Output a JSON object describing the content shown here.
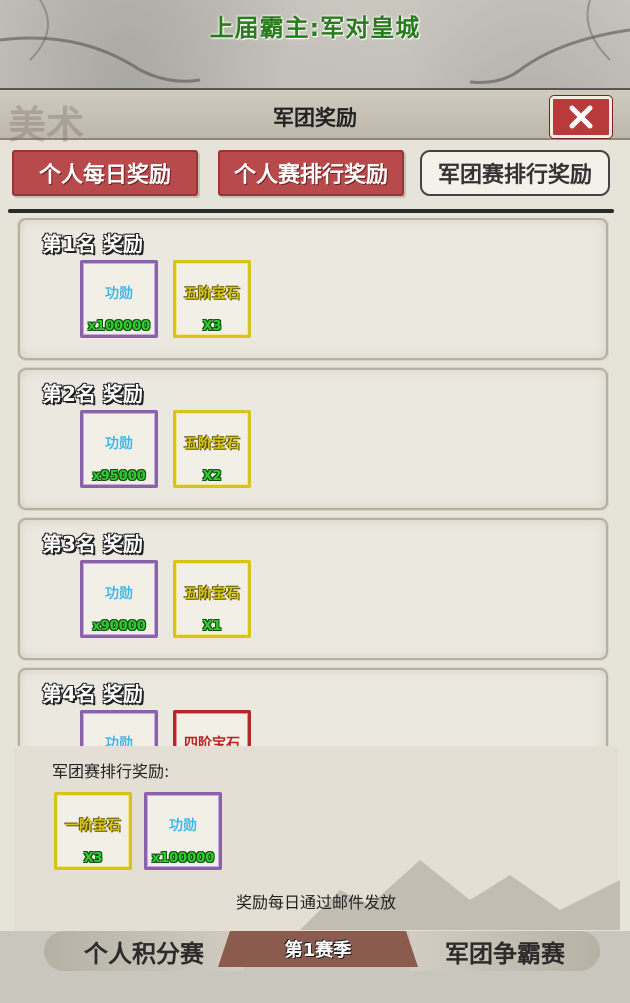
{
  "top_title": "上届霸主:军对皇城",
  "panel": {
    "title": "军团奖励",
    "header_deco": "美术",
    "close_icon": "close-icon"
  },
  "tabs": [
    {
      "label": "个人每日奖励",
      "active": false
    },
    {
      "label": "个人赛排行奖励",
      "active": false
    },
    {
      "label": "军团赛排行奖励",
      "active": true
    }
  ],
  "ranks": [
    {
      "title": "第1名 奖励",
      "items": [
        {
          "name": "功勋",
          "qty": "x100000",
          "rarity": "purple"
        },
        {
          "name": "五阶宝石",
          "qty": "X3",
          "rarity": "yellow"
        }
      ]
    },
    {
      "title": "第2名 奖励",
      "items": [
        {
          "name": "功勋",
          "qty": "x95000",
          "rarity": "purple"
        },
        {
          "name": "五阶宝石",
          "qty": "X2",
          "rarity": "yellow"
        }
      ]
    },
    {
      "title": "第3名 奖励",
      "items": [
        {
          "name": "功勋",
          "qty": "x90000",
          "rarity": "purple"
        },
        {
          "name": "五阶宝石",
          "qty": "X1",
          "rarity": "yellow"
        }
      ]
    },
    {
      "title": "第4名 奖励",
      "items": [
        {
          "name": "功勋",
          "qty": "",
          "rarity": "purple"
        },
        {
          "name": "四阶宝石",
          "qty": "",
          "rarity": "red"
        }
      ]
    }
  ],
  "bottom": {
    "label": "军团赛排行奖励:",
    "items": [
      {
        "name": "一阶宝石",
        "qty": "X3",
        "rarity": "yellow"
      },
      {
        "name": "功勋",
        "qty": "x100000",
        "rarity": "purple"
      }
    ],
    "note": "奖励每日通过邮件发放"
  },
  "bottom_bar": {
    "left": "个人积分赛",
    "center": "第1赛季",
    "right": "军团争霸赛"
  },
  "colors": {
    "tab_active_bg": "#f4f1ea",
    "tab_inactive_bg": "#b84a4c",
    "title_green": "#2a7a1e",
    "qty_green": "#2bd12b",
    "purple_frame": "#8a62a8",
    "yellow_frame": "#d6c41b",
    "red_frame": "#b02828"
  }
}
